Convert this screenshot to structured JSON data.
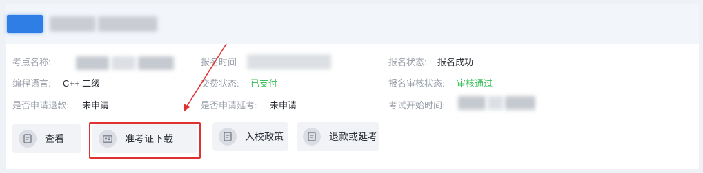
{
  "fields": {
    "row1": {
      "exam_site_label": "考点名称:",
      "reg_time_label": "报名时间",
      "reg_status_label": "报名状态:",
      "reg_status_value": "报名成功"
    },
    "row2": {
      "language_label": "编程语言:",
      "language_value": "C++ 二级",
      "payment_label": "交费状态:",
      "payment_value": "已支付",
      "review_label": "报名审核状态:",
      "review_value": "审核通过"
    },
    "row3": {
      "refund_label": "是否申请退款:",
      "refund_value": "未申请",
      "defer_label": "是否申请延考:",
      "defer_value": "未申请",
      "start_time_label": "考试开始时间:"
    }
  },
  "actions": {
    "view": "查看",
    "admit_ticket": "准考证下载",
    "school_policy": "入校政策",
    "refund_defer": "退款或延考"
  },
  "colors": {
    "accent_blue": "#2f7ee6",
    "success_green": "#3fbf5d",
    "highlight_red": "#e03131"
  },
  "icons": [
    "document-icon",
    "id-card-icon",
    "document-icon",
    "document-icon"
  ]
}
